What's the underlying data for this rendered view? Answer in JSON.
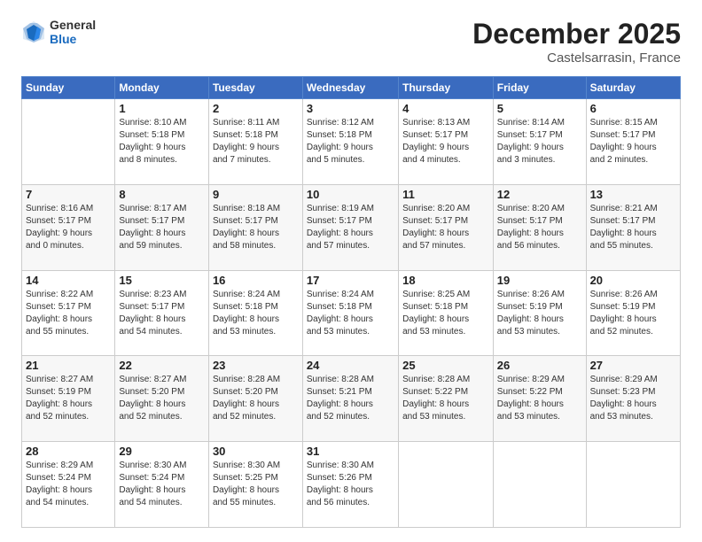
{
  "header": {
    "logo_general": "General",
    "logo_blue": "Blue",
    "month_title": "December 2025",
    "location": "Castelsarrasin, France"
  },
  "days_of_week": [
    "Sunday",
    "Monday",
    "Tuesday",
    "Wednesday",
    "Thursday",
    "Friday",
    "Saturday"
  ],
  "weeks": [
    [
      {
        "day": "",
        "info": ""
      },
      {
        "day": "1",
        "info": "Sunrise: 8:10 AM\nSunset: 5:18 PM\nDaylight: 9 hours\nand 8 minutes."
      },
      {
        "day": "2",
        "info": "Sunrise: 8:11 AM\nSunset: 5:18 PM\nDaylight: 9 hours\nand 7 minutes."
      },
      {
        "day": "3",
        "info": "Sunrise: 8:12 AM\nSunset: 5:18 PM\nDaylight: 9 hours\nand 5 minutes."
      },
      {
        "day": "4",
        "info": "Sunrise: 8:13 AM\nSunset: 5:17 PM\nDaylight: 9 hours\nand 4 minutes."
      },
      {
        "day": "5",
        "info": "Sunrise: 8:14 AM\nSunset: 5:17 PM\nDaylight: 9 hours\nand 3 minutes."
      },
      {
        "day": "6",
        "info": "Sunrise: 8:15 AM\nSunset: 5:17 PM\nDaylight: 9 hours\nand 2 minutes."
      }
    ],
    [
      {
        "day": "7",
        "info": "Sunrise: 8:16 AM\nSunset: 5:17 PM\nDaylight: 9 hours\nand 0 minutes."
      },
      {
        "day": "8",
        "info": "Sunrise: 8:17 AM\nSunset: 5:17 PM\nDaylight: 8 hours\nand 59 minutes."
      },
      {
        "day": "9",
        "info": "Sunrise: 8:18 AM\nSunset: 5:17 PM\nDaylight: 8 hours\nand 58 minutes."
      },
      {
        "day": "10",
        "info": "Sunrise: 8:19 AM\nSunset: 5:17 PM\nDaylight: 8 hours\nand 57 minutes."
      },
      {
        "day": "11",
        "info": "Sunrise: 8:20 AM\nSunset: 5:17 PM\nDaylight: 8 hours\nand 57 minutes."
      },
      {
        "day": "12",
        "info": "Sunrise: 8:20 AM\nSunset: 5:17 PM\nDaylight: 8 hours\nand 56 minutes."
      },
      {
        "day": "13",
        "info": "Sunrise: 8:21 AM\nSunset: 5:17 PM\nDaylight: 8 hours\nand 55 minutes."
      }
    ],
    [
      {
        "day": "14",
        "info": "Sunrise: 8:22 AM\nSunset: 5:17 PM\nDaylight: 8 hours\nand 55 minutes."
      },
      {
        "day": "15",
        "info": "Sunrise: 8:23 AM\nSunset: 5:17 PM\nDaylight: 8 hours\nand 54 minutes."
      },
      {
        "day": "16",
        "info": "Sunrise: 8:24 AM\nSunset: 5:18 PM\nDaylight: 8 hours\nand 53 minutes."
      },
      {
        "day": "17",
        "info": "Sunrise: 8:24 AM\nSunset: 5:18 PM\nDaylight: 8 hours\nand 53 minutes."
      },
      {
        "day": "18",
        "info": "Sunrise: 8:25 AM\nSunset: 5:18 PM\nDaylight: 8 hours\nand 53 minutes."
      },
      {
        "day": "19",
        "info": "Sunrise: 8:26 AM\nSunset: 5:19 PM\nDaylight: 8 hours\nand 53 minutes."
      },
      {
        "day": "20",
        "info": "Sunrise: 8:26 AM\nSunset: 5:19 PM\nDaylight: 8 hours\nand 52 minutes."
      }
    ],
    [
      {
        "day": "21",
        "info": "Sunrise: 8:27 AM\nSunset: 5:19 PM\nDaylight: 8 hours\nand 52 minutes."
      },
      {
        "day": "22",
        "info": "Sunrise: 8:27 AM\nSunset: 5:20 PM\nDaylight: 8 hours\nand 52 minutes."
      },
      {
        "day": "23",
        "info": "Sunrise: 8:28 AM\nSunset: 5:20 PM\nDaylight: 8 hours\nand 52 minutes."
      },
      {
        "day": "24",
        "info": "Sunrise: 8:28 AM\nSunset: 5:21 PM\nDaylight: 8 hours\nand 52 minutes."
      },
      {
        "day": "25",
        "info": "Sunrise: 8:28 AM\nSunset: 5:22 PM\nDaylight: 8 hours\nand 53 minutes."
      },
      {
        "day": "26",
        "info": "Sunrise: 8:29 AM\nSunset: 5:22 PM\nDaylight: 8 hours\nand 53 minutes."
      },
      {
        "day": "27",
        "info": "Sunrise: 8:29 AM\nSunset: 5:23 PM\nDaylight: 8 hours\nand 53 minutes."
      }
    ],
    [
      {
        "day": "28",
        "info": "Sunrise: 8:29 AM\nSunset: 5:24 PM\nDaylight: 8 hours\nand 54 minutes."
      },
      {
        "day": "29",
        "info": "Sunrise: 8:30 AM\nSunset: 5:24 PM\nDaylight: 8 hours\nand 54 minutes."
      },
      {
        "day": "30",
        "info": "Sunrise: 8:30 AM\nSunset: 5:25 PM\nDaylight: 8 hours\nand 55 minutes."
      },
      {
        "day": "31",
        "info": "Sunrise: 8:30 AM\nSunset: 5:26 PM\nDaylight: 8 hours\nand 56 minutes."
      },
      {
        "day": "",
        "info": ""
      },
      {
        "day": "",
        "info": ""
      },
      {
        "day": "",
        "info": ""
      }
    ]
  ]
}
